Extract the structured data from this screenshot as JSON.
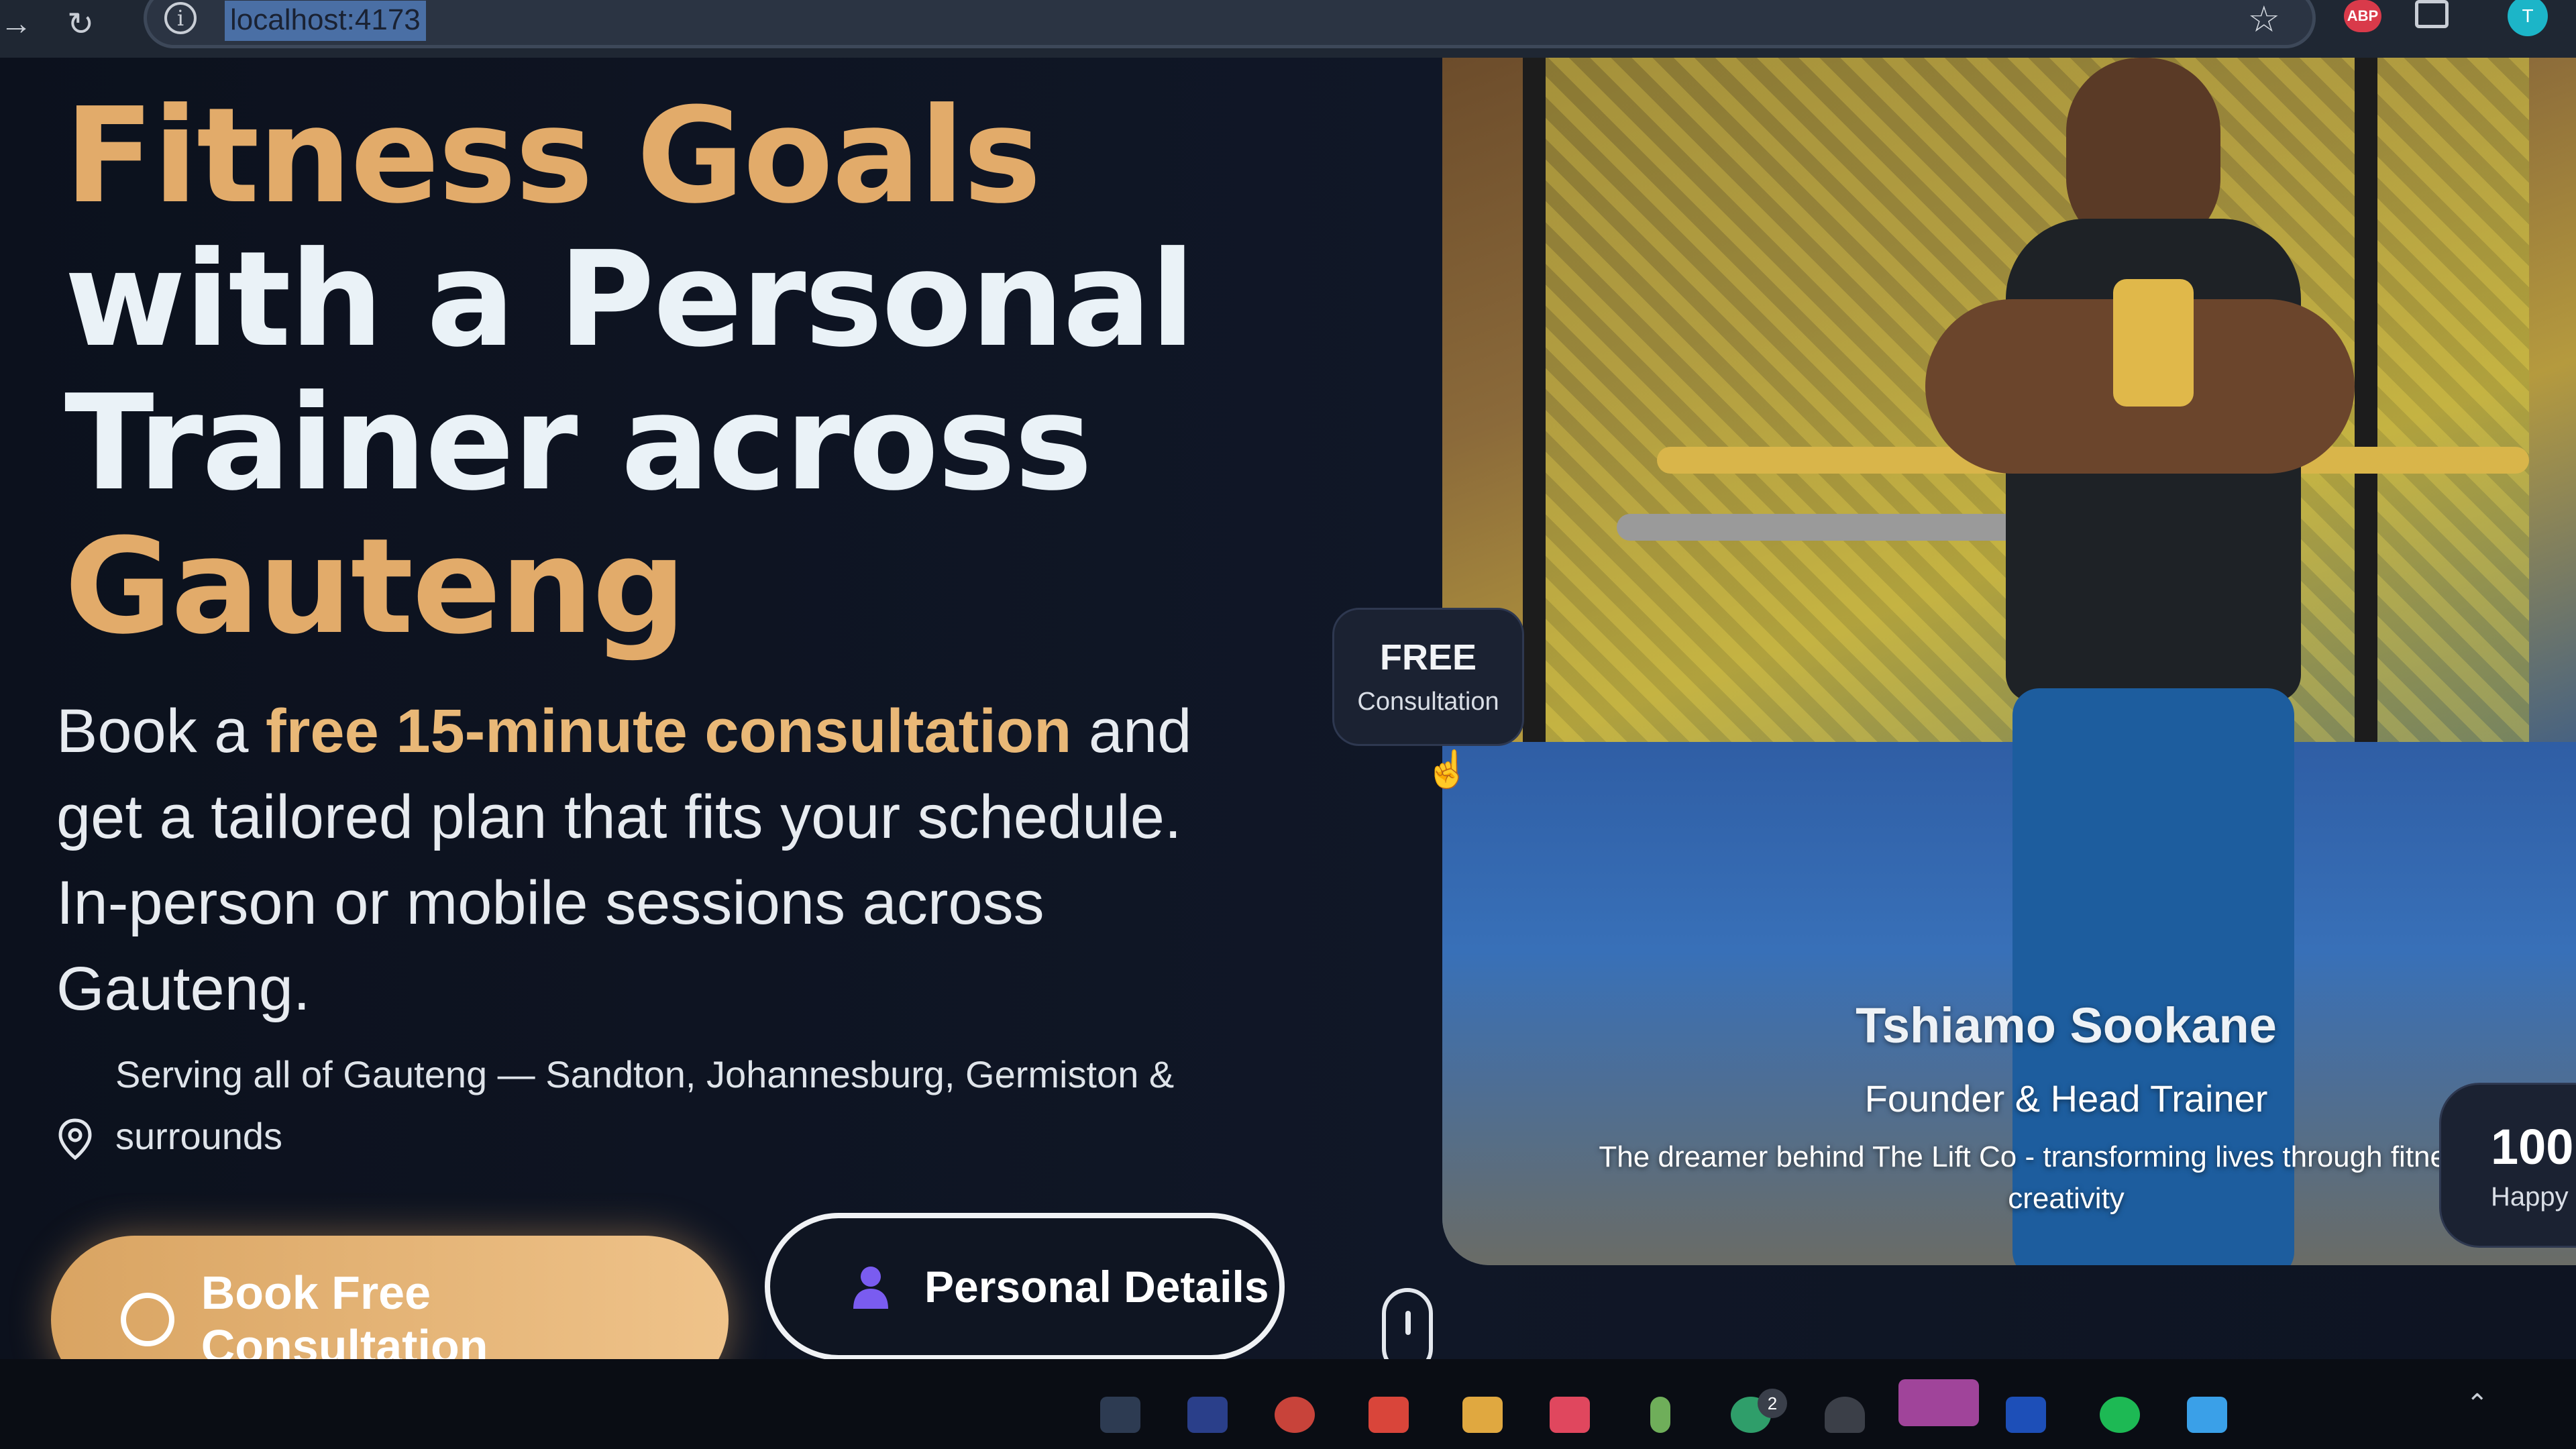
{
  "browser": {
    "url": "localhost:4173",
    "extension_abp": "ABP",
    "profile_initial": "T"
  },
  "hero": {
    "title_line1": "Fitness Goals",
    "title_line2": "with a Personal",
    "title_line3": "Trainer across",
    "title_line4": "Gauteng",
    "lead_prefix": "Book a ",
    "lead_highlight": "free 15-minute consultation",
    "lead_suffix": " and get a tailored plan that fits your schedule. In-person or mobile sessions across Gauteng.",
    "location_text": "Serving all of Gauteng — Sandton, Johannesburg, Germiston & surrounds",
    "book_button": "Book Free Consultation",
    "details_button": "Personal Details"
  },
  "badge_free": {
    "title": "FREE",
    "subtitle": "Consultation"
  },
  "trainer": {
    "name": "Tshiamo Sookane",
    "role": "Founder & Head Trainer",
    "description": "The dreamer behind The Lift Co - transforming lives through fitness and creativity"
  },
  "badge_happy": {
    "number": "100",
    "label": "Happy Cl"
  },
  "taskbar": {
    "badge_count": "2"
  },
  "colors": {
    "gold": "#e2ab6a",
    "background": "#0c111d"
  }
}
